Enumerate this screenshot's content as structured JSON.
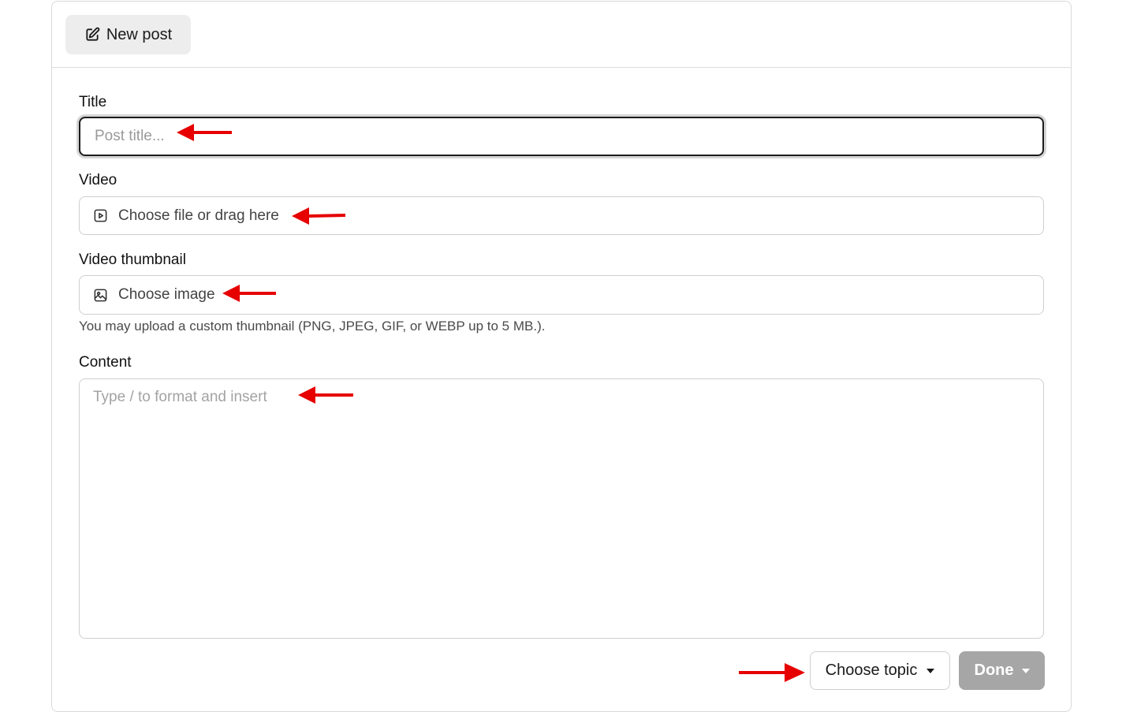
{
  "header": {
    "new_post_label": "New post",
    "new_post_icon": "edit-icon"
  },
  "form": {
    "title_label": "Title",
    "title_placeholder": "Post title...",
    "video_label": "Video",
    "video_upload_text": "Choose file or drag here",
    "video_icon": "video-file-icon",
    "thumbnail_label": "Video thumbnail",
    "thumbnail_upload_text": "Choose image",
    "thumbnail_icon": "image-icon",
    "thumbnail_hint": "You may upload a custom thumbnail (PNG, JPEG, GIF, or WEBP up to 5 MB.).",
    "content_label": "Content",
    "content_placeholder": "Type / to format and insert"
  },
  "footer": {
    "topic_label": "Choose topic",
    "done_label": "Done"
  },
  "annotations": {
    "arrow_color": "#e60000"
  },
  "colors": {
    "done_bg": "#a6a6a6",
    "new_post_bg": "#ededed"
  }
}
